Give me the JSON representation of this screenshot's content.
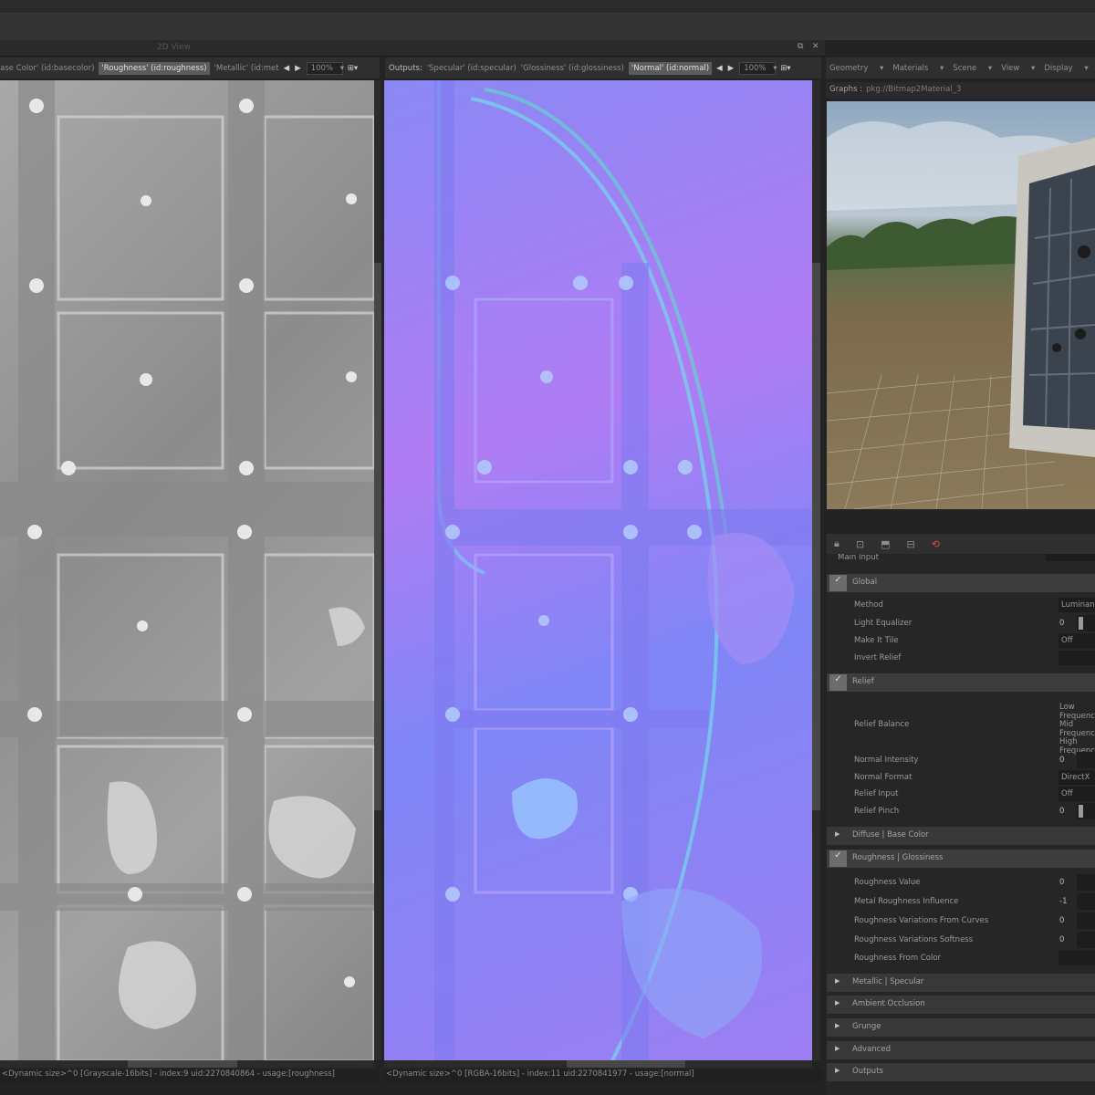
{
  "view2d": {
    "title": "2D View",
    "icons": [
      "restore-icon",
      "close-icon"
    ]
  },
  "left_panel": {
    "tabs": [
      "'Base Color' (id:basecolor)",
      "'Roughness' (id:roughness)",
      "'Metallic' (id:met"
    ],
    "selected_tab": 1,
    "zoom": "100%",
    "status": "<Dynamic size>^0 [Grayscale-16bits] - index:9 uid:2270840864 - usage:[roughness]"
  },
  "right_panel": {
    "outputs_label": "Outputs:",
    "tabs": [
      "'Specular' (id:specular)",
      "'Glossiness' (id:glossiness)",
      "'Normal' (id:normal)"
    ],
    "selected_tab": 2,
    "zoom": "100%",
    "status": "<Dynamic size>^0 [RGBA-16bits] - index:11 uid:2270841977 - usage:[normal]"
  },
  "view3d": {
    "menus": [
      "Geometry",
      "Materials",
      "Scene",
      "View",
      "Display"
    ],
    "graphs_label": "Graphs :",
    "graphs_value": "pkg://Bitmap2Material_3"
  },
  "properties": {
    "main_input_label": "Main Input",
    "sections": {
      "global": {
        "title": "Global",
        "rows": [
          {
            "label": "Method",
            "value": "Luminance"
          },
          {
            "label": "Light Equalizer",
            "value": "0"
          },
          {
            "label": "Make It Tile",
            "value": "Off"
          },
          {
            "label": "Invert Relief",
            "value": ""
          }
        ]
      },
      "relief": {
        "title": "Relief",
        "balance_label": "Relief Balance",
        "freqs": [
          "Low Frequency",
          "Mid Frequency",
          "High Frequency"
        ],
        "rows": [
          {
            "label": "Normal Intensity",
            "value": "0"
          },
          {
            "label": "Normal Format",
            "value": "DirectX"
          },
          {
            "label": "Relief Input",
            "value": "Off"
          },
          {
            "label": "Relief Pinch",
            "value": "0"
          }
        ]
      },
      "diffuse": {
        "title": "Diffuse | Base Color"
      },
      "roughness": {
        "title": "Roughness | Glossiness",
        "rows": [
          {
            "label": "Roughness Value",
            "value": "0"
          },
          {
            "label": "Metal Roughness Influence",
            "value": "-1"
          },
          {
            "label": "Roughness Variations From Curves",
            "value": "0"
          },
          {
            "label": "Roughness Variations Softness",
            "value": "0"
          },
          {
            "label": "Roughness From Color",
            "value": ""
          }
        ]
      },
      "metallic": {
        "title": "Metallic | Specular"
      },
      "ao": {
        "title": "Ambient Occlusion"
      },
      "grunge": {
        "title": "Grunge"
      },
      "advanced": {
        "title": "Advanced"
      },
      "outputs": {
        "title": "Outputs"
      }
    }
  }
}
